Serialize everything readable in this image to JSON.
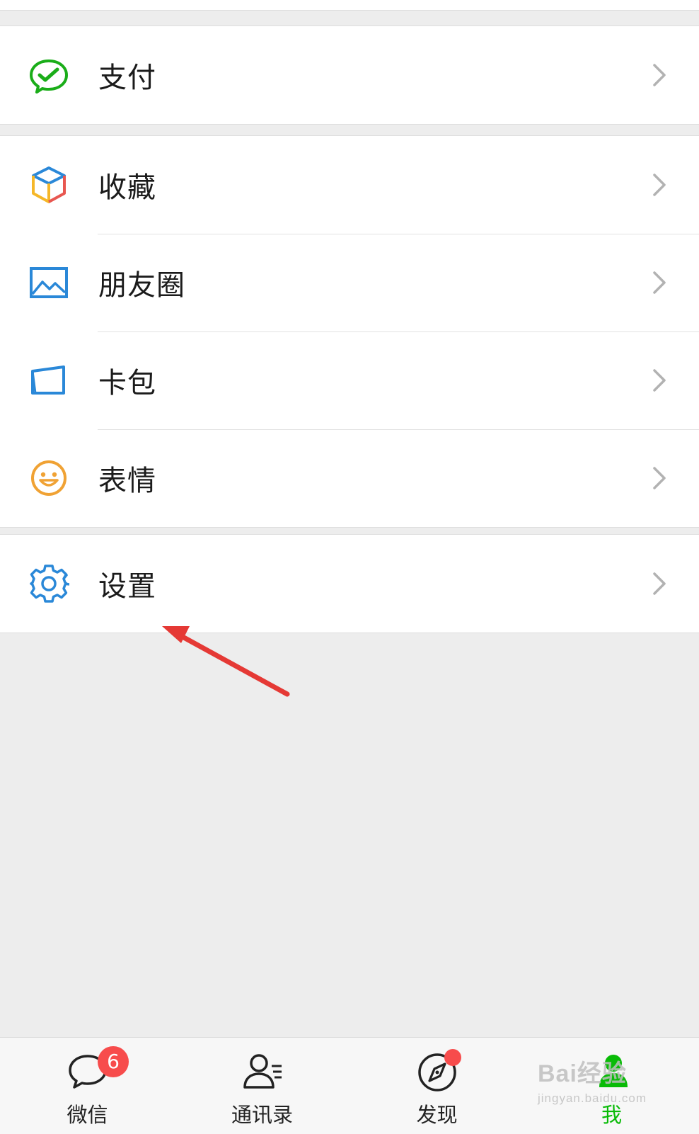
{
  "menu": {
    "pay": {
      "label": "支付",
      "icon": "wechat-pay-icon"
    },
    "favorites": {
      "label": "收藏",
      "icon": "cube-icon"
    },
    "moments": {
      "label": "朋友圈",
      "icon": "picture-icon"
    },
    "cards": {
      "label": "卡包",
      "icon": "card-wallet-icon"
    },
    "stickers": {
      "label": "表情",
      "icon": "smiley-icon"
    },
    "settings": {
      "label": "设置",
      "icon": "gear-icon"
    }
  },
  "tabbar": {
    "chats": {
      "label": "微信",
      "badge": "6",
      "icon": "chat-bubble-icon"
    },
    "contacts": {
      "label": "通讯录",
      "icon": "contacts-icon"
    },
    "discover": {
      "label": "发现",
      "icon": "compass-icon"
    },
    "me": {
      "label": "我",
      "icon": "person-icon"
    }
  },
  "watermark": {
    "brand": "Bai经验",
    "url": "jingyan.baidu.com"
  },
  "colors": {
    "accent_green": "#09bb07",
    "badge_red": "#f74c4c",
    "annotation_arrow": "#e53935",
    "gear_blue": "#2a88d8"
  }
}
